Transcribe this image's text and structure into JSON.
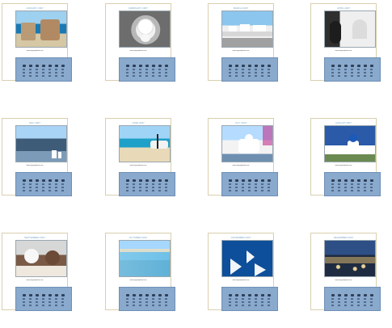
{
  "months": [
    {
      "key": "jan",
      "title": "JANUARY 2007",
      "caption": "www.aegeanphoto.com"
    },
    {
      "key": "feb",
      "title": "FEBRUARY 2007",
      "caption": "www.aegeanphoto.com"
    },
    {
      "key": "mar",
      "title": "MARCH 2007",
      "caption": "www.aegeanphoto.com"
    },
    {
      "key": "apr",
      "title": "APRIL 2007",
      "caption": "www.aegeanphoto.com"
    },
    {
      "key": "may",
      "title": "MAY 2007",
      "caption": "www.aegeanphoto.com"
    },
    {
      "key": "jun",
      "title": "JUNE 2007",
      "caption": "www.aegeanphoto.com"
    },
    {
      "key": "jul",
      "title": "JULY 2007",
      "caption": "www.aegeanphoto.com"
    },
    {
      "key": "aug",
      "title": "AUGUST 2007",
      "caption": "www.aegeanphoto.com"
    },
    {
      "key": "sep",
      "title": "SEPTEMBER 2007",
      "caption": "www.aegeanphoto.com"
    },
    {
      "key": "oct",
      "title": "OCTOBER 2007",
      "caption": "www.aegeanphoto.com"
    },
    {
      "key": "nov",
      "title": "NOVEMBER 2007",
      "caption": "www.aegeanphoto.com"
    },
    {
      "key": "dec",
      "title": "DECEMBER 2007",
      "caption": "www.aegeanphoto.com"
    }
  ]
}
